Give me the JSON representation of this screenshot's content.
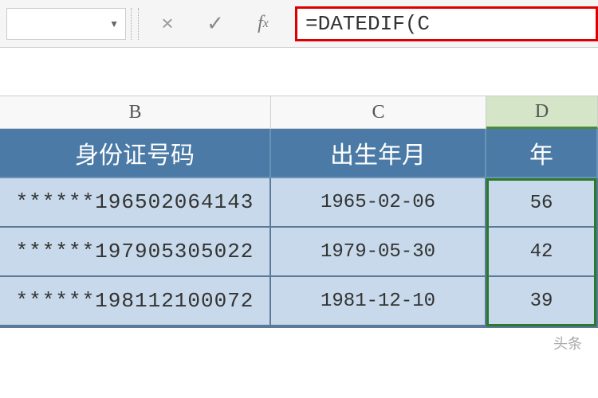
{
  "formula_bar": {
    "name_box": "",
    "formula": "=DATEDIF(C"
  },
  "columns": {
    "b": "B",
    "c": "C",
    "d": "D"
  },
  "headers": {
    "id": "身份证号码",
    "birth": "出生年月",
    "age": "年"
  },
  "rows": [
    {
      "id": "******196502064143",
      "birth": "1965-02-06",
      "age": "56"
    },
    {
      "id": "******197905305022",
      "birth": "1979-05-30",
      "age": "42"
    },
    {
      "id": "******198112100072",
      "birth": "1981-12-10",
      "age": "39"
    }
  ],
  "watermark": "头条"
}
